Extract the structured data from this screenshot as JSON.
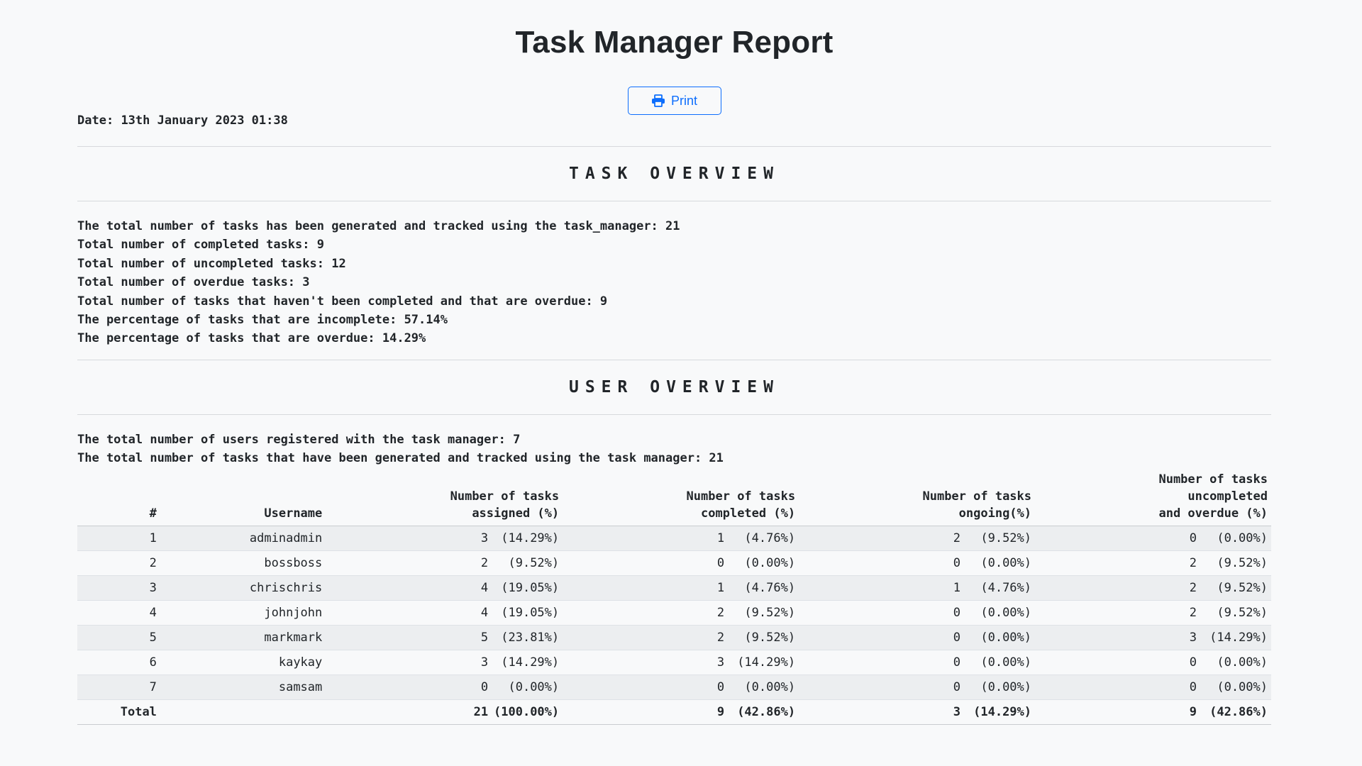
{
  "report": {
    "title": "Task Manager Report",
    "print_label": "Print",
    "print_icon": "printer-icon",
    "date_label": "Date:",
    "date_value": "13th January 2023 01:38",
    "accent": "#0d6efd"
  },
  "task_overview": {
    "heading": "TASK OVERVIEW",
    "lines": [
      "The total number of tasks has been generated and tracked using the task_manager: 21",
      "Total number of completed tasks: 9",
      "Total number of uncompleted tasks: 12",
      "Total number of overdue tasks: 3",
      "Total number of tasks that haven't been completed and that are overdue: 9",
      "The percentage of tasks that are incomplete: 57.14%",
      "The percentage of tasks that are overdue: 14.29%"
    ]
  },
  "user_overview": {
    "heading": "USER OVERVIEW",
    "lines": [
      "The total number of users registered with the task manager: 7",
      "The total number of tasks that have been generated and tracked using the task manager: 21"
    ],
    "table": {
      "headers": {
        "num": "#",
        "username": "Username",
        "assigned": [
          "Number of tasks",
          "assigned (%)"
        ],
        "completed": [
          "Number of tasks",
          "completed (%)"
        ],
        "ongoing": [
          "Number of tasks",
          "ongoing(%)"
        ],
        "overdue": [
          "Number of tasks",
          "uncompleted",
          "and overdue (%)"
        ]
      },
      "rows": [
        {
          "num": "1",
          "username": "adminadmin",
          "assigned": "3",
          "assigned_pct": "(14.29%)",
          "completed": "1",
          "completed_pct": "(4.76%)",
          "ongoing": "2",
          "ongoing_pct": "(9.52%)",
          "overdue": "0",
          "overdue_pct": "(0.00%)"
        },
        {
          "num": "2",
          "username": "bossboss",
          "assigned": "2",
          "assigned_pct": "(9.52%)",
          "completed": "0",
          "completed_pct": "(0.00%)",
          "ongoing": "0",
          "ongoing_pct": "(0.00%)",
          "overdue": "2",
          "overdue_pct": "(9.52%)"
        },
        {
          "num": "3",
          "username": "chrischris",
          "assigned": "4",
          "assigned_pct": "(19.05%)",
          "completed": "1",
          "completed_pct": "(4.76%)",
          "ongoing": "1",
          "ongoing_pct": "(4.76%)",
          "overdue": "2",
          "overdue_pct": "(9.52%)"
        },
        {
          "num": "4",
          "username": "johnjohn",
          "assigned": "4",
          "assigned_pct": "(19.05%)",
          "completed": "2",
          "completed_pct": "(9.52%)",
          "ongoing": "0",
          "ongoing_pct": "(0.00%)",
          "overdue": "2",
          "overdue_pct": "(9.52%)"
        },
        {
          "num": "5",
          "username": "markmark",
          "assigned": "5",
          "assigned_pct": "(23.81%)",
          "completed": "2",
          "completed_pct": "(9.52%)",
          "ongoing": "0",
          "ongoing_pct": "(0.00%)",
          "overdue": "3",
          "overdue_pct": "(14.29%)"
        },
        {
          "num": "6",
          "username": "kaykay",
          "assigned": "3",
          "assigned_pct": "(14.29%)",
          "completed": "3",
          "completed_pct": "(14.29%)",
          "ongoing": "0",
          "ongoing_pct": "(0.00%)",
          "overdue": "0",
          "overdue_pct": "(0.00%)"
        },
        {
          "num": "7",
          "username": "samsam",
          "assigned": "0",
          "assigned_pct": "(0.00%)",
          "completed": "0",
          "completed_pct": "(0.00%)",
          "ongoing": "0",
          "ongoing_pct": "(0.00%)",
          "overdue": "0",
          "overdue_pct": "(0.00%)"
        }
      ],
      "total": {
        "label": "Total",
        "assigned": "21",
        "assigned_pct": "(100.00%)",
        "completed": "9",
        "completed_pct": "(42.86%)",
        "ongoing": "3",
        "ongoing_pct": "(14.29%)",
        "overdue": "9",
        "overdue_pct": "(42.86%)"
      }
    }
  }
}
